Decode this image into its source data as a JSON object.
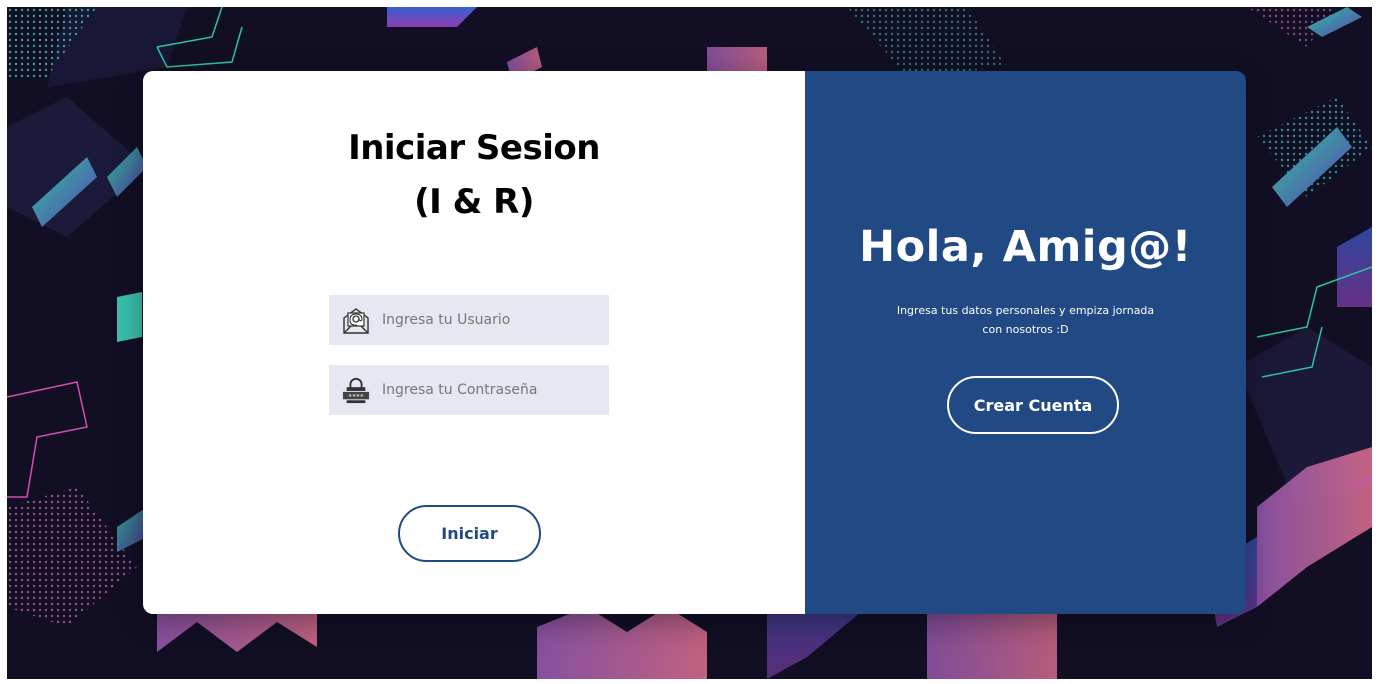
{
  "login": {
    "title_line1": "Iniciar Sesion",
    "title_line2": "(I & R)",
    "username_placeholder": "Ingresa tu Usuario",
    "password_placeholder": "Ingresa tu Contraseña",
    "username_icon": "envelope-at-icon",
    "password_icon": "lock-password-icon",
    "submit_label": "Iniciar"
  },
  "welcome": {
    "title": "Hola, Amig@!",
    "message": "Ingresa tus datos personales y empiza jornada con nosotros :D",
    "signup_label": "Crear Cuenta"
  },
  "colors": {
    "accent": "#214a84",
    "background": "#120f25",
    "input_bg": "#e6e8f1"
  }
}
